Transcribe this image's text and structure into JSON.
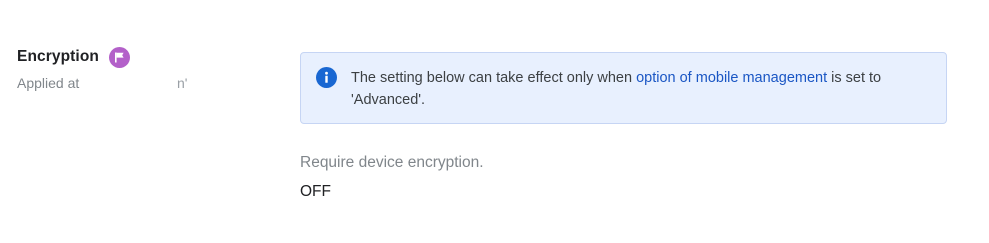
{
  "setting": {
    "title": "Encryption",
    "flag_icon": "flag-icon",
    "flag_color": "#b360c9",
    "applied_label": "Applied at",
    "applied_value": "n'"
  },
  "info": {
    "icon": "info-icon",
    "text_before": "The setting below can take effect only when ",
    "link_text": "option of mobile management",
    "text_after": " is set to 'Advanced'.",
    "background": "#e8f0fe",
    "link_color": "#1a56c4"
  },
  "requirement": {
    "label": "Require device encryption.",
    "value": "OFF"
  }
}
